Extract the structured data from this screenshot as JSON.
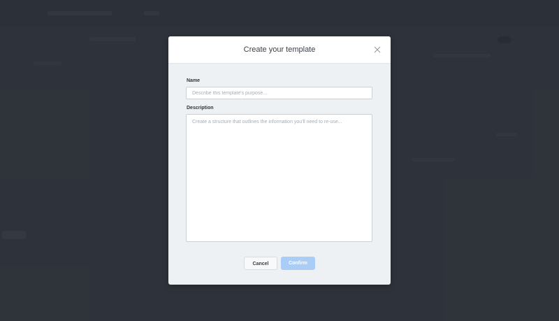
{
  "modal": {
    "title": "Create your template",
    "name_label": "Name",
    "name_placeholder": "Describe this template's purpose...",
    "name_value": "",
    "description_label": "Description",
    "description_placeholder": "Create a structure that outlines the information you'll need to re-use...",
    "description_value": "",
    "cancel_label": "Cancel",
    "confirm_label": "Confirm",
    "close_icon": "close-icon"
  },
  "colors": {
    "backdrop": "#383d45",
    "modal_body": "#eef1f4",
    "modal_header": "#ffffff",
    "confirm_disabled": "#a9cdf7"
  }
}
